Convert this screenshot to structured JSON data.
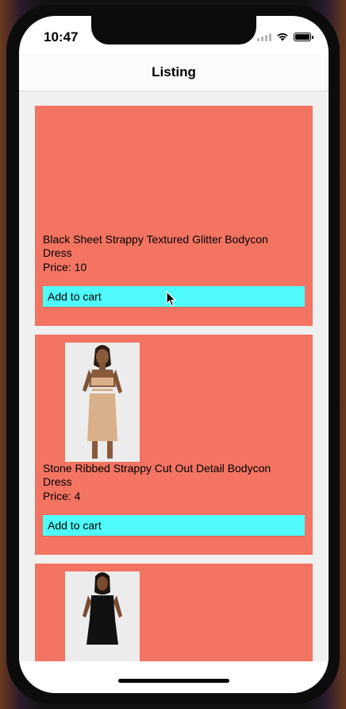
{
  "status_bar": {
    "time": "10:47"
  },
  "nav": {
    "title": "Listing"
  },
  "products": [
    {
      "name": "Black Sheet Strappy Textured Glitter Bodycon Dress",
      "price": "Price: 10",
      "button": "Add to cart",
      "image": "none"
    },
    {
      "name": "Stone Ribbed Strappy Cut Out Detail Bodycon Dress",
      "price": "Price: 4",
      "button": "Add to cart",
      "image": "model-in-beige-bodycon-dress"
    },
    {
      "image": "model-in-black-dress"
    }
  ],
  "colors": {
    "card": "#f37463",
    "button": "#4ffcfb",
    "background": "#f0f0f0"
  }
}
